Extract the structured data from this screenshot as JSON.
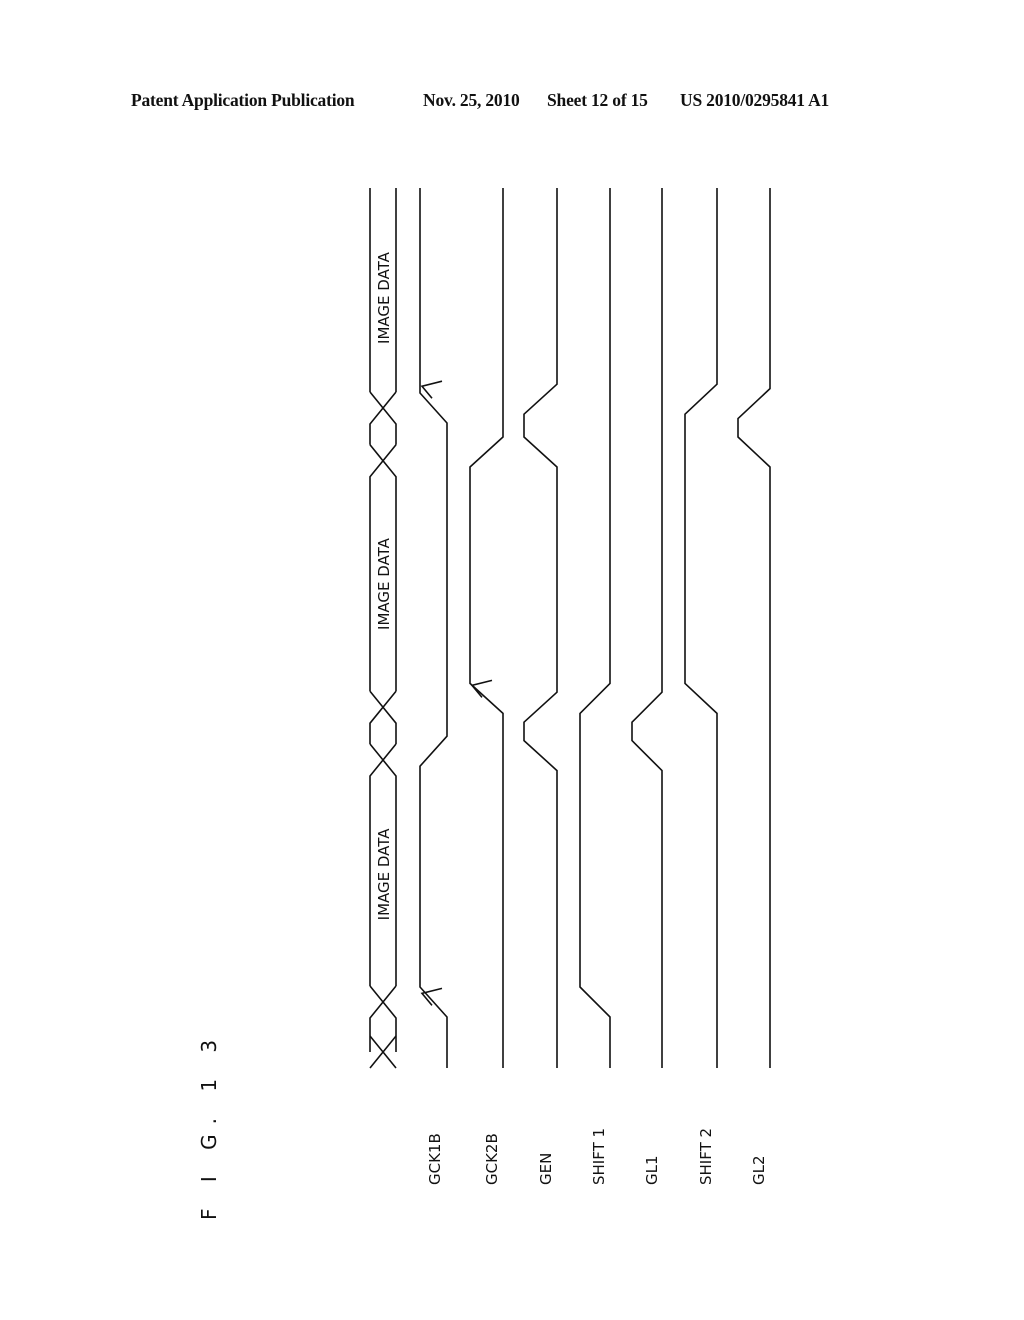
{
  "header": {
    "publication": "Patent Application Publication",
    "date": "Nov. 25, 2010",
    "sheet": "Sheet 12 of 15",
    "number": "US 2010/0295841 A1"
  },
  "figure": {
    "label": "F I G. 1 3",
    "orientation": "rotated 90 degrees counter-clockwise; time increases bottom to top"
  },
  "bus": {
    "name": "data-bus",
    "segments": [
      {
        "label": "IMAGE DATA",
        "from": 0.09,
        "to": 0.35
      },
      {
        "label": "IMAGE DATA",
        "from": 0.41,
        "to": 0.69
      },
      {
        "label": "IMAGE DATA",
        "from": 0.75,
        "to": 1.0
      }
    ],
    "crossings": [
      0.0,
      0.075,
      0.35,
      0.41,
      0.69,
      0.75
    ]
  },
  "signals": [
    {
      "name": "GCK1B",
      "initial": 1,
      "transitions": [
        0.075,
        0.36,
        0.75
      ],
      "arrows_at": [
        0.07,
        0.76
      ]
    },
    {
      "name": "GCK2B",
      "initial": 1,
      "transitions": [
        0.42,
        0.7
      ],
      "arrows_at": [
        0.42
      ]
    },
    {
      "name": "GEN",
      "initial": 1,
      "transitions": [
        0.355,
        0.41,
        0.7,
        0.76
      ]
    },
    {
      "name": "SHIFT 1",
      "initial": 1,
      "transitions": [
        0.075,
        0.42
      ]
    },
    {
      "name": "GL1",
      "initial": 1,
      "transitions": [
        0.355,
        0.41
      ]
    },
    {
      "name": "SHIFT 2",
      "initial": 1,
      "transitions": [
        0.42,
        0.76
      ]
    },
    {
      "name": "GL2",
      "initial": 1,
      "transitions": [
        0.7,
        0.755
      ]
    }
  ],
  "colors": {
    "ink": "#111111",
    "paper": "#ffffff"
  }
}
